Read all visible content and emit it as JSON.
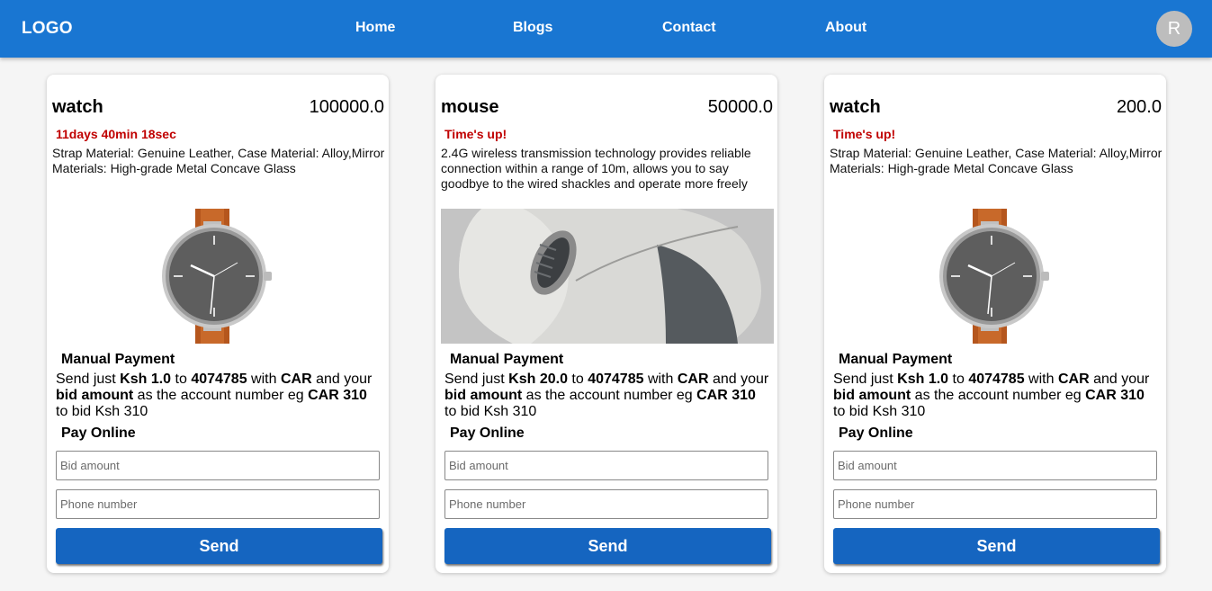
{
  "header": {
    "logo": "LOGO",
    "nav": [
      {
        "label": "Home"
      },
      {
        "label": "Blogs"
      },
      {
        "label": "Contact"
      },
      {
        "label": "About"
      }
    ],
    "avatar_letter": "R"
  },
  "colors": {
    "brand": "#1976d2",
    "button": "#1565c0",
    "timer": "#c00000"
  },
  "cards": [
    {
      "title": "watch",
      "price": "100000.0",
      "timer": "11days 40min 18sec",
      "description": "Strap Material: Genuine Leather, Case Material: Alloy,Mirror Materials: High-grade Metal Concave Glass",
      "image": "watch-image",
      "manual_heading": "Manual Payment",
      "instructions": {
        "p1": "Send just ",
        "amount": "Ksh 1.0",
        "p2": " to ",
        "phone": "4074785",
        "p3": " with ",
        "code": "CAR",
        "p4": " and your ",
        "bid": "bid amount",
        "p5": " as the account number eg ",
        "example": "CAR 310",
        "p6": " to bid Ksh 310"
      },
      "online_heading": "Pay Online",
      "bid_placeholder": "Bid amount",
      "phone_placeholder": "Phone number",
      "send_label": "Send"
    },
    {
      "title": "mouse",
      "price": "50000.0",
      "timer": "Time's up!",
      "description": "2.4G wireless transmission technology provides reliable connection within a range of 10m, allows you to say goodbye to the wired shackles and operate more freely",
      "image": "mouse-image",
      "manual_heading": "Manual Payment",
      "instructions": {
        "p1": "Send just ",
        "amount": "Ksh 20.0",
        "p2": " to ",
        "phone": "4074785",
        "p3": " with ",
        "code": "CAR",
        "p4": " and your ",
        "bid": "bid amount",
        "p5": " as the account number eg ",
        "example": "CAR 310",
        "p6": " to bid Ksh 310"
      },
      "online_heading": "Pay Online",
      "bid_placeholder": "Bid amount",
      "phone_placeholder": "Phone number",
      "send_label": "Send"
    },
    {
      "title": "watch",
      "price": "200.0",
      "timer": "Time's up!",
      "description": "Strap Material: Genuine Leather, Case Material: Alloy,Mirror Materials: High-grade Metal Concave Glass",
      "image": "watch-image",
      "manual_heading": "Manual Payment",
      "instructions": {
        "p1": "Send just ",
        "amount": "Ksh 1.0",
        "p2": " to ",
        "phone": "4074785",
        "p3": " with ",
        "code": "CAR",
        "p4": " and your ",
        "bid": "bid amount",
        "p5": " as the account number eg ",
        "example": "CAR 310",
        "p6": " to bid Ksh 310"
      },
      "online_heading": "Pay Online",
      "bid_placeholder": "Bid amount",
      "phone_placeholder": "Phone number",
      "send_label": "Send"
    }
  ]
}
